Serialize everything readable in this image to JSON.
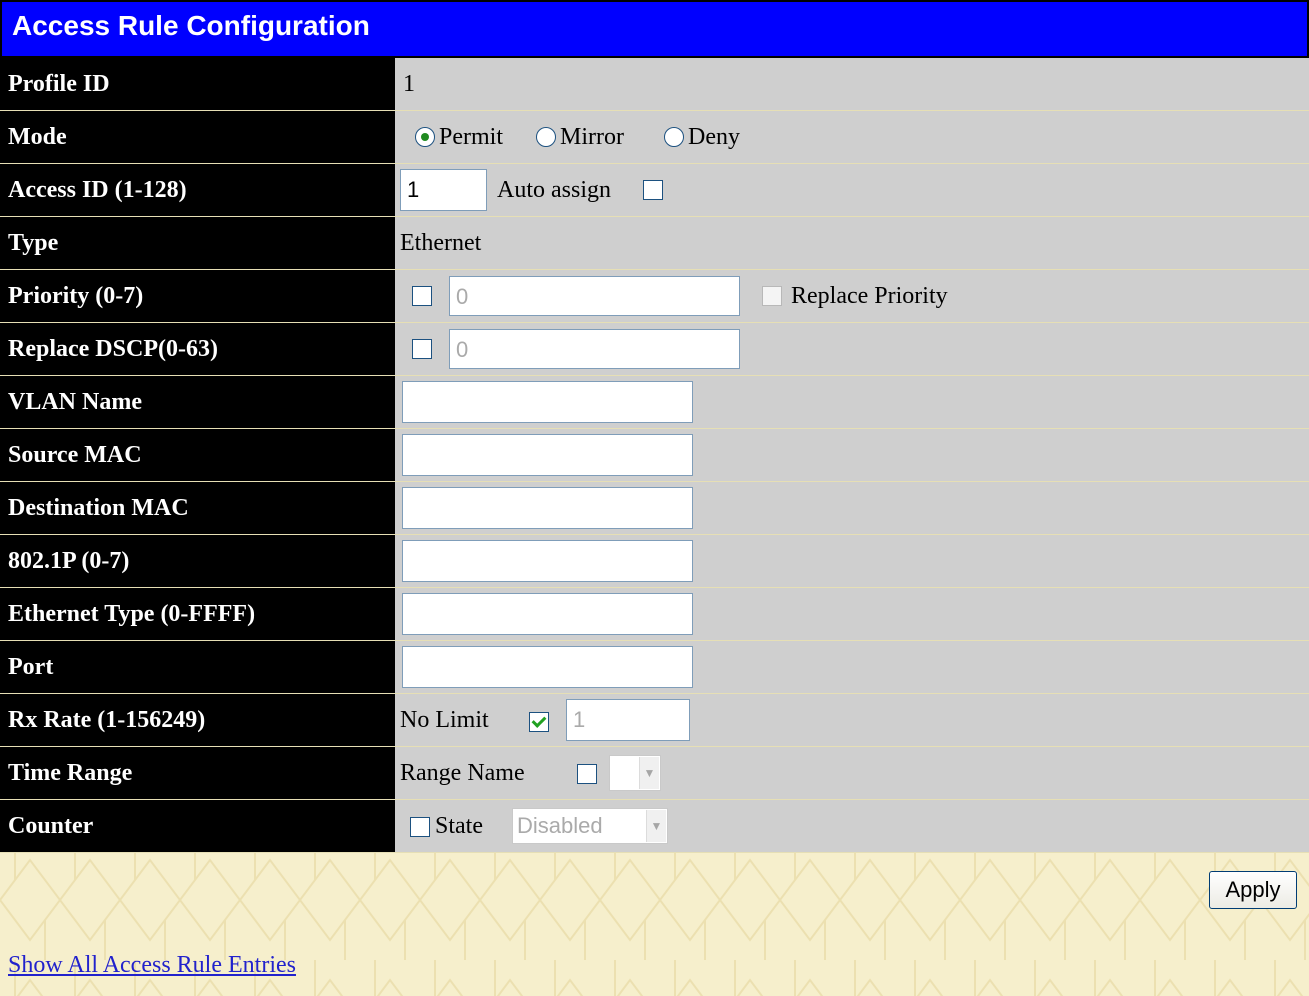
{
  "title": "Access Rule Configuration",
  "fields": {
    "profile_id": {
      "label": "Profile ID",
      "value": "1"
    },
    "mode": {
      "label": "Mode",
      "options": [
        "Permit",
        "Mirror",
        "Deny"
      ],
      "selected": "Permit"
    },
    "access_id": {
      "label": "Access ID (1-128)",
      "value": "1",
      "auto_assign_label": "Auto assign",
      "auto_assign_checked": false
    },
    "type": {
      "label": "Type",
      "value": "Ethernet"
    },
    "priority": {
      "label": "Priority (0-7)",
      "checked": false,
      "value": "0",
      "replace_label": "Replace Priority",
      "replace_checked": false
    },
    "replace_dscp": {
      "label": "Replace DSCP(0-63)",
      "checked": false,
      "value": "0"
    },
    "vlan_name": {
      "label": "VLAN Name",
      "value": ""
    },
    "source_mac": {
      "label": "Source MAC",
      "value": ""
    },
    "destination_mac": {
      "label": "Destination MAC",
      "value": ""
    },
    "dot1p": {
      "label": "802.1P (0-7)",
      "value": ""
    },
    "ethernet_type": {
      "label": "Ethernet Type (0-FFFF)",
      "value": ""
    },
    "port": {
      "label": "Port",
      "value": ""
    },
    "rx_rate": {
      "label": "Rx Rate (1-156249)",
      "no_limit_label": "No Limit",
      "no_limit_checked": true,
      "value": "1"
    },
    "time_range": {
      "label": "Time Range",
      "range_name_label": "Range Name",
      "range_name_checked": false,
      "selected": ""
    },
    "counter": {
      "label": "Counter",
      "state_label": "State",
      "state_checked": false,
      "selected": "Disabled"
    }
  },
  "apply_label": "Apply",
  "show_all_link": "Show All Access Rule Entries",
  "colors": {
    "title_bg": "#0000ff",
    "label_bg": "#000000",
    "value_bg": "#cfcfcf",
    "page_bg": "#f6efcc",
    "link": "#2222cc"
  }
}
